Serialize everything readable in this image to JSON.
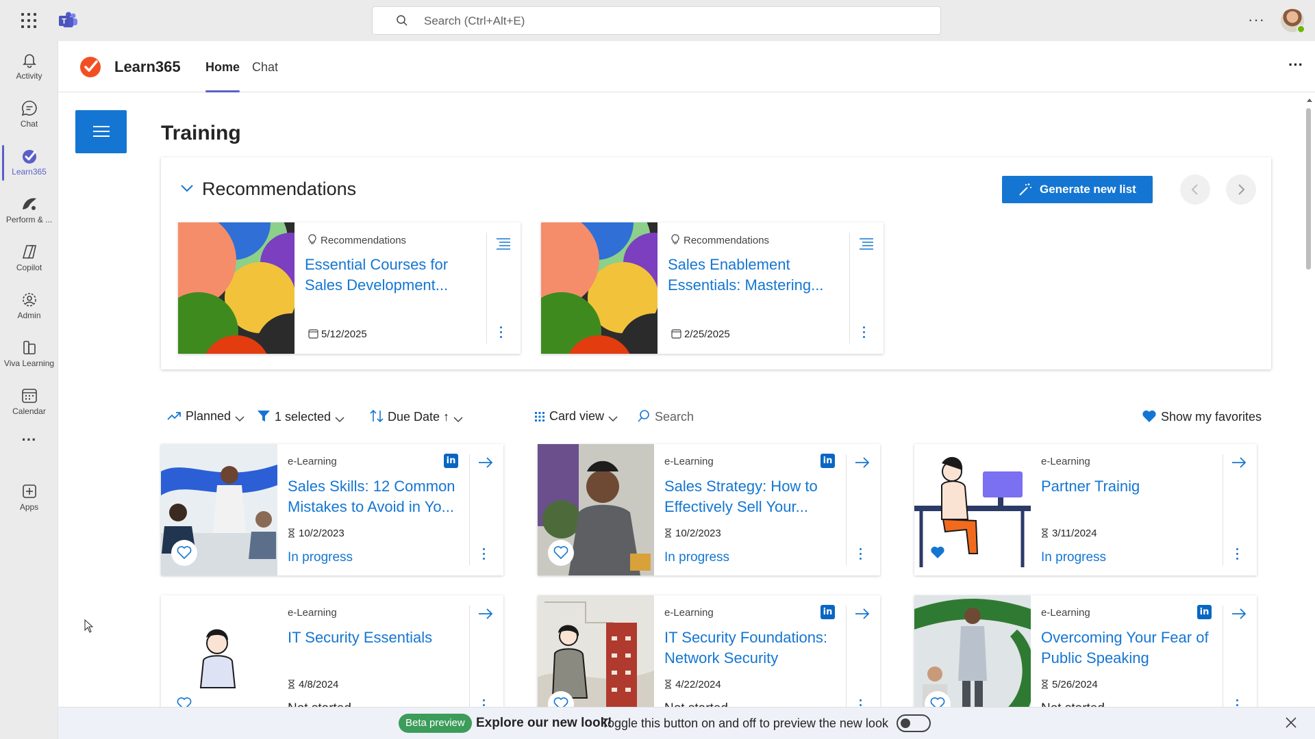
{
  "topbar": {
    "search_placeholder": "Search (Ctrl+Alt+E)",
    "more_label": "···"
  },
  "rail": {
    "items": [
      {
        "label": "Activity",
        "icon": "bell-icon"
      },
      {
        "label": "Chat",
        "icon": "chat-icon"
      },
      {
        "label": "Learn365",
        "icon": "learn365-icon"
      },
      {
        "label": "Perform & ...",
        "icon": "perform-icon"
      },
      {
        "label": "Copilot",
        "icon": "copilot-icon"
      },
      {
        "label": "Admin",
        "icon": "admin-icon"
      },
      {
        "label": "Viva Learning",
        "icon": "viva-learning-icon"
      },
      {
        "label": "Calendar",
        "icon": "calendar-icon"
      },
      {
        "label": "···",
        "icon": "more-icon"
      },
      {
        "label": "Apps",
        "icon": "apps-icon"
      }
    ]
  },
  "app": {
    "name": "Learn365",
    "tabs": [
      {
        "label": "Home"
      },
      {
        "label": "Chat"
      }
    ],
    "more_label": "···"
  },
  "page": {
    "title": "Training"
  },
  "recommendations": {
    "title": "Recommendations",
    "generate_label": "Generate new list",
    "cards": [
      {
        "tag": "Recommendations",
        "title": "Essential Courses for Sales Development...",
        "date": "5/12/2025"
      },
      {
        "tag": "Recommendations",
        "title": "Sales Enablement Essentials: Mastering...",
        "date": "2/25/2025"
      }
    ]
  },
  "filters": {
    "planned": "Planned",
    "selected": "1 selected",
    "sort": "Due Date ↑",
    "view": "Card view",
    "search": "Search",
    "favorites": "Show my favorites"
  },
  "courses": [
    {
      "type": "e-Learning",
      "title": "Sales Skills: 12 Common Mistakes to Avoid in Yo...",
      "date": "10/2/2023",
      "status": "In progress",
      "linkedin": true,
      "favorite": false
    },
    {
      "type": "e-Learning",
      "title": "Sales Strategy: How to Effectively Sell Your...",
      "date": "10/2/2023",
      "status": "In progress",
      "linkedin": true,
      "favorite": false
    },
    {
      "type": "e-Learning",
      "title": "Partner Trainig",
      "date": "3/11/2024",
      "status": "In progress",
      "linkedin": false,
      "favorite": true
    },
    {
      "type": "e-Learning",
      "title": "IT Security Essentials",
      "date": "4/8/2024",
      "status": "Not started",
      "linkedin": false,
      "favorite": false
    },
    {
      "type": "e-Learning",
      "title": "IT Security Foundations: Network Security",
      "date": "4/22/2024",
      "status": "Not started",
      "linkedin": true,
      "favorite": false
    },
    {
      "type": "e-Learning",
      "title": "Overcoming Your Fear of Public Speaking",
      "date": "5/26/2024",
      "status": "Not started",
      "linkedin": true,
      "favorite": false
    }
  ],
  "banner": {
    "pill": "Beta preview",
    "headline": "Explore our new look!",
    "message": "Toggle this button on and off to preview the new look"
  },
  "colors": {
    "accent": "#1476d2",
    "teams_purple": "#5b5fc7",
    "linkedin": "#0a66c2",
    "learn365_orange": "#f25022"
  }
}
